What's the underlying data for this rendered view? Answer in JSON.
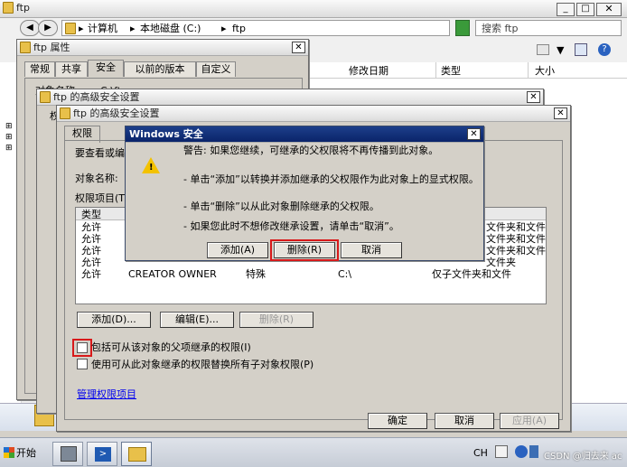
{
  "explorer": {
    "title": "ftp",
    "breadcrumb": [
      "计算机",
      "本地磁盘 (C:)",
      "ftp"
    ],
    "search_placeholder": "搜索 ftp",
    "columns": [
      "修改日期",
      "类型",
      "大小"
    ]
  },
  "properties": {
    "title": "ftp 属性",
    "tabs": [
      "常规",
      "共享",
      "安全",
      "以前的版本",
      "自定义"
    ],
    "object_label": "对象名称:",
    "object_value": "C:\\ftp"
  },
  "advanced_back": {
    "title": "ftp 的高级安全设置",
    "tab": "权限"
  },
  "advanced": {
    "title": "ftp 的高级安全设置",
    "tab": "权限",
    "intro": "要查看或编辑",
    "object_label": "对象名称:",
    "entries_label": "权限项目(T):",
    "col_type": "类型",
    "rows": [
      {
        "type": "允许",
        "name": "",
        "perm": "",
        "inherit": "",
        "apply": "文件夹和文件"
      },
      {
        "type": "允许",
        "name": "",
        "perm": "",
        "inherit": "",
        "apply": "文件夹和文件"
      },
      {
        "type": "允许",
        "name": "",
        "perm": "",
        "inherit": "",
        "apply": "文件夹和文件"
      },
      {
        "type": "允许",
        "name": "",
        "perm": "",
        "inherit": "",
        "apply": "文件夹"
      },
      {
        "type": "允许",
        "name": "CREATOR OWNER",
        "perm": "特殊",
        "inherit": "C:\\",
        "apply": "仅子文件夹和文件"
      }
    ],
    "add_btn": "添加(D)...",
    "edit_btn": "编辑(E)...",
    "remove_btn": "删除(R)",
    "include_inheritable": "包括可从该对象的父项继承的权限(I)",
    "replace_child": "使用可从此对象继承的权限替换所有子对象权限(P)",
    "manage_link": "管理权限项目",
    "ok": "确定",
    "cancel": "取消",
    "apply": "应用(A)"
  },
  "dialog": {
    "title": "Windows 安全",
    "warning": "警告: 如果您继续，可继承的父权限将不再传播到此对象。",
    "bullet1": "- 单击“添加”以转换并添加继承的父权限作为此对象上的显式权限。",
    "bullet2": "- 单击“删除”以从此对象删除继承的父权限。",
    "bullet3": "- 如果您此时不想修改继承设置，请单击“取消”。",
    "add": "添加(A)",
    "remove": "删除(R)",
    "cancel": "取消"
  },
  "taskbar": {
    "start": "开始",
    "lang": "CH",
    "watermark": "CSDN @归去来 ac"
  }
}
